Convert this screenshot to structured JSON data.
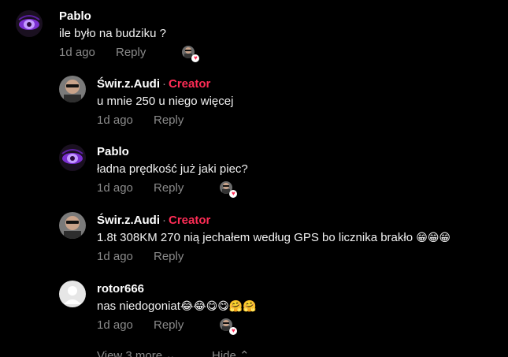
{
  "comments": [
    {
      "name": "Pablo",
      "text": "ile było na budziku ?",
      "time": "1d ago",
      "reply": "Reply",
      "creator_label": "",
      "liked_by_creator": true
    },
    {
      "name": "Świr.z.Audi",
      "separator": "·",
      "creator_label": "Creator",
      "text": "u mnie 250 u niego więcej",
      "time": "1d ago",
      "reply": "Reply",
      "liked_by_creator": false
    },
    {
      "name": "Pablo",
      "text": "ładna prędkość już jaki piec?",
      "time": "1d ago",
      "reply": "Reply",
      "creator_label": "",
      "liked_by_creator": true
    },
    {
      "name": "Świr.z.Audi",
      "separator": "·",
      "creator_label": "Creator",
      "text": "1.8t 308KM 270 nią jechałem według GPS bo licznika brakło",
      "emoji": "😁😁😁",
      "time": "1d ago",
      "reply": "Reply",
      "liked_by_creator": false
    },
    {
      "name": "rotor666",
      "text": "nas niedogoniat",
      "emoji": "😂😂😋😋🤗🤗",
      "time": "1d ago",
      "reply": "Reply",
      "creator_label": "",
      "liked_by_creator": true
    }
  ],
  "footer": {
    "view_more": "View 3 more ⌄",
    "hide": "Hide ⌃"
  },
  "colors": {
    "background": "#000000",
    "creator": "#fe2c55",
    "muted": "#8a8a8a"
  },
  "icons": {
    "pablo_avatar": "purple-eye-avatar",
    "swir_avatar": "man-sunglasses-avatar",
    "rotor_avatar": "default-user-avatar",
    "heart": "heart-icon"
  }
}
